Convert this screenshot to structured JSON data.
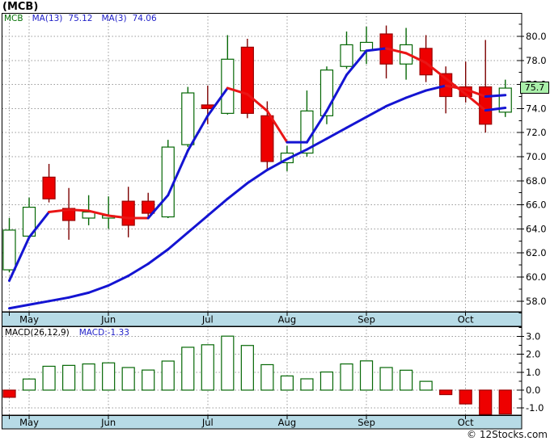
{
  "title": "(MCB)",
  "legend": {
    "symbol": "MCB",
    "ma13_label": "MA(13)",
    "ma13_value": "75.12",
    "ma3_label": "MA(3)",
    "ma3_value": "74.06"
  },
  "macd_legend": {
    "label": "MACD(26,12,9)",
    "value": "MACD:-1.33"
  },
  "price_box": {
    "value": "75.7"
  },
  "watermark": "© 12Stocks.com",
  "colors": {
    "strip_bg": "#b7dbe6",
    "grid": "#9a9a9a",
    "candle_up_stroke": "#066806",
    "candle_down_fill": "#ee0000",
    "candle_down_stroke": "#990000",
    "candle_down_wick": "#7d0000",
    "ma_blue": "#1414d2",
    "ma_red": "#ea1515",
    "macd_neg_fill": "#ee0000",
    "price_box_bg": "#aaf0aa",
    "legend_blue": "#2121c8",
    "legend_green": "#067306"
  },
  "chart_data": {
    "type": "candlestick",
    "symbol": "MCB",
    "title": "(MCB)",
    "months": [
      "May",
      "Jun",
      "Jul",
      "Aug",
      "Sep",
      "Oct"
    ],
    "month_candle_index": [
      1,
      5,
      10,
      14,
      18,
      23
    ],
    "price_axis_ticks": [
      80,
      78,
      76,
      74,
      72,
      70,
      68,
      66,
      64,
      62,
      60,
      58
    ],
    "price_axis_range": [
      56.9,
      82.0
    ],
    "last_price": 75.7,
    "candles": [
      [
        60.6,
        64.9,
        60.4,
        63.9
      ],
      [
        63.4,
        66.6,
        63.2,
        65.8
      ],
      [
        68.3,
        69.4,
        66.2,
        66.5
      ],
      [
        65.7,
        67.4,
        63.1,
        64.7
      ],
      [
        64.9,
        66.8,
        64.3,
        65.4
      ],
      [
        64.9,
        66.7,
        64.0,
        65.1
      ],
      [
        66.3,
        67.5,
        63.3,
        64.3
      ],
      [
        66.3,
        67.0,
        64.9,
        65.3
      ],
      [
        65.0,
        71.4,
        64.9,
        70.8
      ],
      [
        71.0,
        75.8,
        70.8,
        75.3
      ],
      [
        74.3,
        75.9,
        72.7,
        74.0
      ],
      [
        73.6,
        80.1,
        73.5,
        78.1
      ],
      [
        79.1,
        79.8,
        73.2,
        73.6
      ],
      [
        73.4,
        74.6,
        69.0,
        69.6
      ],
      [
        69.5,
        70.9,
        68.8,
        70.3
      ],
      [
        70.3,
        75.5,
        70.0,
        73.8
      ],
      [
        73.4,
        77.5,
        72.7,
        77.2
      ],
      [
        77.5,
        80.4,
        77.3,
        79.3
      ],
      [
        78.8,
        80.8,
        77.7,
        79.5
      ],
      [
        80.2,
        80.9,
        76.5,
        77.7
      ],
      [
        77.7,
        80.7,
        76.4,
        79.3
      ],
      [
        79.0,
        80.1,
        76.2,
        76.8
      ],
      [
        76.9,
        77.5,
        73.6,
        75.0
      ],
      [
        75.8,
        77.9,
        74.5,
        75.0
      ],
      [
        75.8,
        79.7,
        72.0,
        72.7
      ],
      [
        73.7,
        76.4,
        73.3,
        75.7
      ]
    ],
    "ma3": {
      "label": "MA(3)",
      "current": 74.06,
      "values": [
        59.7,
        63.3,
        65.4,
        65.6,
        65.5,
        65.1,
        64.9,
        64.9,
        66.8,
        70.5,
        73.4,
        75.7,
        75.2,
        73.8,
        71.2,
        71.2,
        73.8,
        76.8,
        78.8,
        79.0,
        78.6,
        77.8,
        76.5,
        75.2,
        73.85,
        74.06
      ],
      "segment_colors": [
        "b",
        "b",
        "r",
        "r",
        "r",
        "r",
        "r",
        "b",
        "b",
        "b",
        "b",
        "r",
        "r",
        "r",
        "b",
        "b",
        "b",
        "b",
        "b",
        "r",
        "r",
        "r",
        "r",
        "r",
        "b"
      ]
    },
    "ma13": {
      "label": "MA(13)",
      "current": 75.12,
      "values": [
        57.4,
        57.7,
        58.0,
        58.3,
        58.7,
        59.3,
        60.1,
        61.1,
        62.3,
        63.7,
        65.1,
        66.5,
        67.8,
        68.9,
        69.8,
        70.6,
        71.5,
        72.4,
        73.3,
        74.2,
        74.9,
        75.5,
        75.9,
        75.6,
        75.0,
        75.12
      ],
      "segment_colors": [
        "b",
        "b",
        "b",
        "b",
        "b",
        "b",
        "b",
        "b",
        "b",
        "b",
        "b",
        "b",
        "b",
        "b",
        "b",
        "b",
        "b",
        "b",
        "b",
        "b",
        "b",
        "b",
        "r",
        "r",
        "b"
      ]
    },
    "macd": {
      "label": "MACD(26,12,9)",
      "current": -1.33,
      "axis_ticks": [
        3.0,
        2.0,
        1.0,
        0.0,
        -1.0
      ],
      "values": [
        -0.4,
        0.62,
        1.33,
        1.38,
        1.46,
        1.52,
        1.26,
        1.12,
        1.62,
        2.39,
        2.53,
        3.01,
        2.49,
        1.42,
        0.79,
        0.63,
        1.01,
        1.46,
        1.63,
        1.26,
        1.11,
        0.49,
        -0.25,
        -0.77,
        -1.43,
        -1.33
      ]
    }
  }
}
